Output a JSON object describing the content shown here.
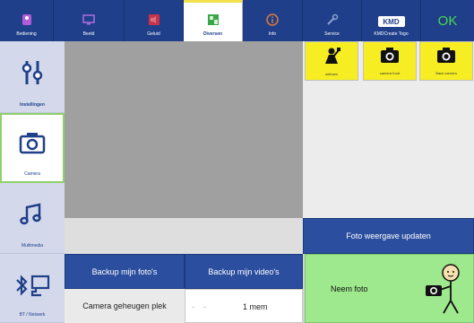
{
  "tabs": [
    {
      "label": "Bediening",
      "icon": "remote-icon"
    },
    {
      "label": "Beeld",
      "icon": "monitor-icon"
    },
    {
      "label": "Geluid",
      "icon": "speaker-icon"
    },
    {
      "label": "Diversen",
      "icon": "misc-icon"
    },
    {
      "label": "Info",
      "icon": "info-icon"
    },
    {
      "label": "Service",
      "icon": "wrench-icon"
    },
    {
      "label": "KMDCreate Togo",
      "icon": "kmd-logo-icon",
      "logo_text": "KMD"
    }
  ],
  "ok_label": "OK",
  "sidebar": [
    {
      "label": "Instellingen",
      "icon": "settings-sliders-icon"
    },
    {
      "label": "Camera",
      "icon": "camera-icon"
    },
    {
      "label": "Multimedia",
      "icon": "music-note-icon"
    },
    {
      "label": "BT / Netwerk",
      "icon": "bluetooth-network-icon"
    }
  ],
  "thumbnails": [
    {
      "caption": "selfcam",
      "icon": "selfie-icon"
    },
    {
      "caption": "camera front",
      "icon": "camera-icon"
    },
    {
      "caption": "Back camera",
      "icon": "camera-icon"
    }
  ],
  "buttons": {
    "update_photo_view": "Foto weergave updaten",
    "backup_photos": "Backup mijn foto's",
    "backup_videos": "Backup mijn video's",
    "take_photo": "Neem foto"
  },
  "storage": {
    "label": "Camera geheugen plek",
    "value": "1 mem",
    "decrement": "-",
    "increment": "-"
  },
  "colors": {
    "tab_bg": "#1f3f8a",
    "ok_text": "#4cd84c",
    "thumb_bg": "#f6ed22",
    "take_photo_bg": "#9ee88d",
    "selected_border": "#8fd16b"
  }
}
